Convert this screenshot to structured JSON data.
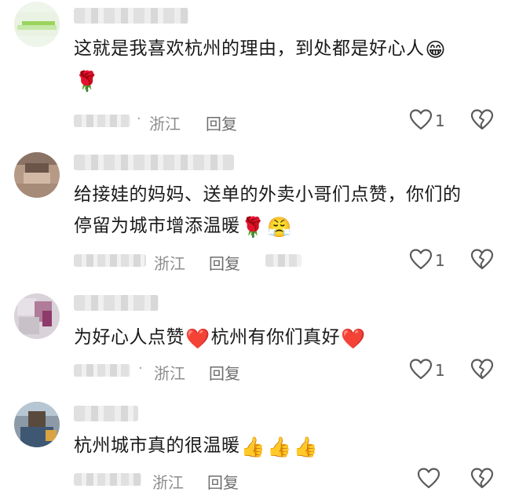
{
  "comments": [
    {
      "text_main": "这就是我喜欢杭州的理由，到处都是好心人",
      "emojis": [
        "😁",
        "🌹"
      ],
      "location": "浙江",
      "reply_label": "回复",
      "like_count": "1"
    },
    {
      "text_line1": "给接娃的妈妈、送单的外卖小哥们点赞，你们的",
      "text_line2": "停留为城市增添温暖",
      "emojis": [
        "🌹",
        "😤"
      ],
      "location": "浙江",
      "reply_label": "回复",
      "like_count": "1"
    },
    {
      "text_part1": "为好心人点赞",
      "text_part2": "杭州有你们真好",
      "emojis": [
        "❤️",
        "❤️"
      ],
      "location": "浙江",
      "reply_label": "回复",
      "like_count": "1"
    },
    {
      "text_main": "杭州城市真的很温暖",
      "emojis": [
        "👍",
        "👍",
        "👍"
      ],
      "location": "浙江",
      "reply_label": "回复",
      "like_count": ""
    }
  ],
  "separator": "·",
  "colors": {
    "text": "#1a1a1a",
    "meta": "#8c8c8c",
    "icon": "#5a5a5a"
  }
}
